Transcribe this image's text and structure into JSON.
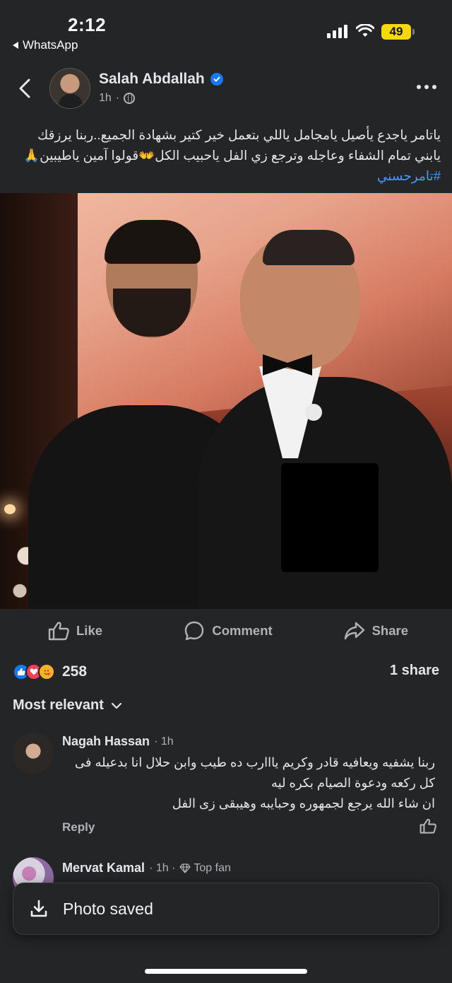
{
  "status_bar": {
    "time": "2:12",
    "back_app": "WhatsApp",
    "battery": "49"
  },
  "post": {
    "author": "Salah Abdallah",
    "time": "1h",
    "visibility_sep": "·",
    "text_main": "ياتامر ياجدع يأصيل يامجامل ياللي بتعمل خير كتير بشهادة الجميع..ربنا يرزقك يابني تمام الشفاء وعاجله وترجع زي الفل ياحبيب الكل👐قولوا آمين ياطيبين🙏",
    "hashtag": "#تامرحسني"
  },
  "actions": {
    "like": "Like",
    "comment": "Comment",
    "share": "Share"
  },
  "stats": {
    "reaction_count": "258",
    "shares": "1 share"
  },
  "sort": {
    "label": "Most relevant"
  },
  "comments": [
    {
      "name": "Nagah Hassan",
      "meta": "· 1h",
      "text": "ربنا  يشفيه  ويعافيه    قادر وكريم  يااارب    ده طيب وابن حلال انا بدعيله فى كل ركعه    ودعوة الصيام بكره ليه\nان شاء الله يرجع  لجمهوره وحبايبه    وهيبقى زى الفل",
      "reply": "Reply"
    },
    {
      "name": "Mervat Kamal",
      "meta": "· 1h ·",
      "badge": "Top fan"
    }
  ],
  "toast": {
    "text": "Photo saved"
  },
  "colors": {
    "background": "#242526",
    "text": "#e4e6eb",
    "muted": "#b0b3b8",
    "link": "#4599ff",
    "verified": "#1877f2",
    "battery": "#f5d90a"
  }
}
